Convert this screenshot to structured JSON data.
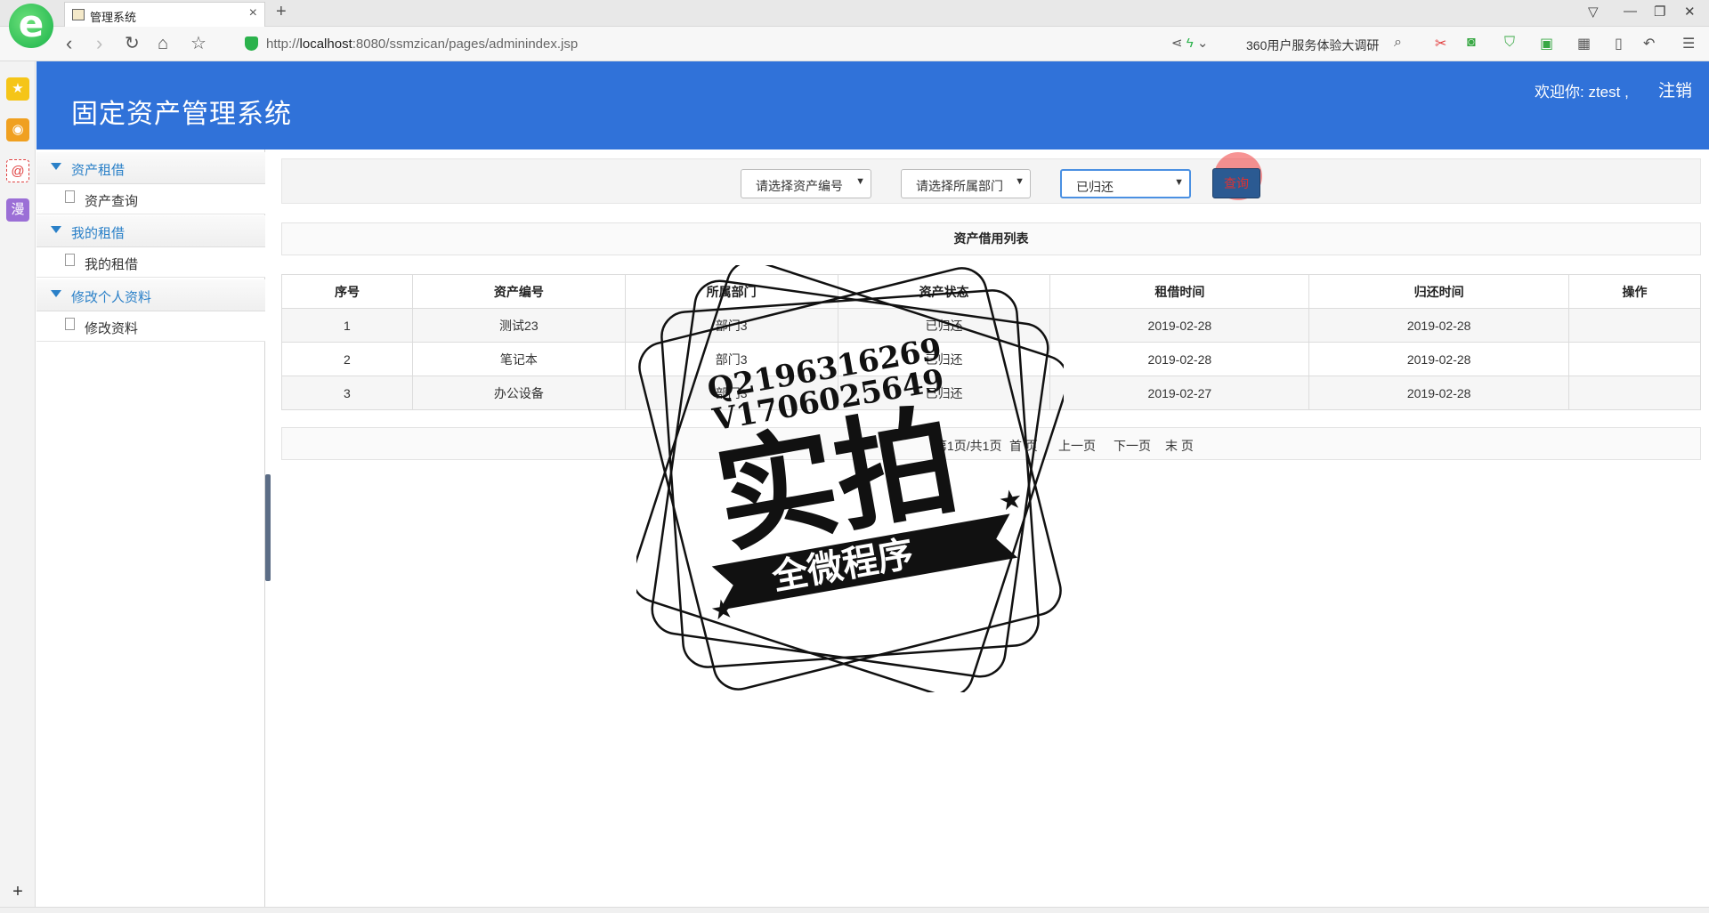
{
  "browser": {
    "tab_title": "管理系统",
    "tab_close": "×",
    "new_tab": "+",
    "url_prefix": "http://",
    "url_host": "localhost",
    "url_rest": ":8080/ssmzican/pages/adminindex.jsp",
    "promo": "360用户服务体验大调研"
  },
  "app": {
    "title": "固定资产管理系统",
    "welcome": "欢迎你: ztest ,",
    "logout": "注销"
  },
  "sidebar": {
    "groups": [
      {
        "title": "资产租借",
        "item": "资产查询"
      },
      {
        "title": "我的租借",
        "item": "我的租借"
      },
      {
        "title": "修改个人资料",
        "item": "修改资料"
      }
    ]
  },
  "filters": {
    "asset_no": "请选择资产编号",
    "department": "请选择所属部门",
    "status": "已归还",
    "query_button": "查询"
  },
  "table": {
    "caption": "资产借用列表",
    "headers": [
      "序号",
      "资产编号",
      "所属部门",
      "资产状态",
      "租借时间",
      "归还时间",
      "操作"
    ],
    "rows": [
      [
        "1",
        "测试23",
        "部门3",
        "已归还",
        "2019-02-28",
        "2019-02-28",
        ""
      ],
      [
        "2",
        "笔记本",
        "部门3",
        "已归还",
        "2019-02-28",
        "2019-02-28",
        ""
      ],
      [
        "3",
        "办公设备",
        "部门3",
        "已归还",
        "2019-02-27",
        "2019-02-28",
        ""
      ]
    ]
  },
  "pager": {
    "info": "第1页/共1页",
    "first": "首 页",
    "prev": "上一页",
    "next": "下一页",
    "last": "末 页"
  },
  "watermark": {
    "line1": "Q2196316269",
    "line2": "V1706025649",
    "big": "实拍",
    "ribbon": "全微程序"
  },
  "colors": {
    "header_bg": "#3072d9",
    "menu_accent": "#2a80c8",
    "query_button": "#2b5a92"
  }
}
